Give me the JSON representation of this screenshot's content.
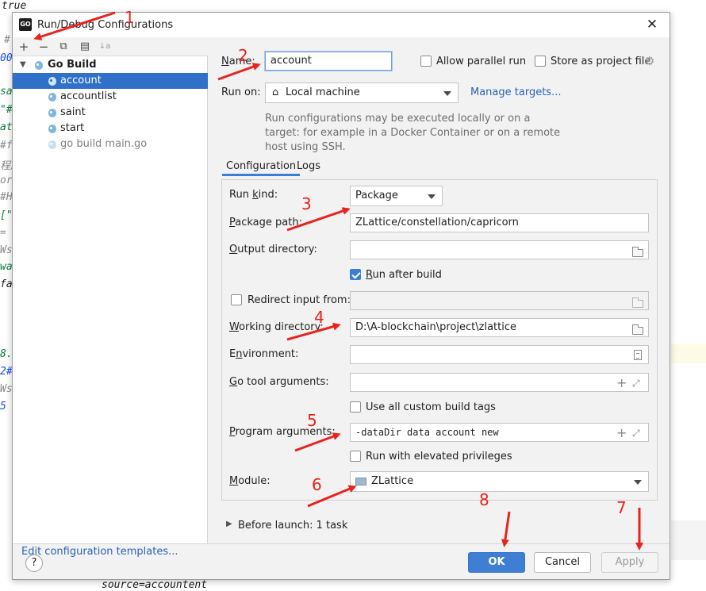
{
  "editor": {
    "lines": [
      {
        "text": "true",
        "color": "#1a1a1a"
      },
      {
        "text": "#自动见证,默认使用第一个账户进行见证",
        "color": "#8a8a8a"
      },
      {
        "text": "#",
        "color": "#8a8a8a"
      },
      {
        "text": "00",
        "color": "#1750eb"
      },
      {
        "text": "sa",
        "color": "#0a7a3a"
      },
      {
        "text": "\"#",
        "color": "#0a7a3a"
      },
      {
        "text": "at",
        "color": "#0a7a3a"
      },
      {
        "text": "#f",
        "color": "#8a8a8a"
      },
      {
        "text": "程序",
        "color": "#8a8a8a"
      },
      {
        "text": "or",
        "color": "#8a8a8a"
      },
      {
        "text": "#H",
        "color": "#8a8a8a"
      },
      {
        "text": "[\"",
        "color": "#0a7a3a"
      },
      {
        "text": "=",
        "color": "#8a8a8a"
      },
      {
        "text": "Ws",
        "color": "#8a8a8a"
      },
      {
        "text": "wa",
        "color": "#0a7a3a"
      },
      {
        "text": "fa",
        "color": "#1a1a1a"
      },
      {
        "text": "8.",
        "color": "#0a7a3a"
      },
      {
        "text": "2#",
        "color": "#1750eb"
      },
      {
        "text": "Ws",
        "color": "#8a8a8a"
      },
      {
        "text": "5",
        "color": "#1750eb"
      },
      {
        "text": "source=accountent",
        "color": "#1a1a1a"
      }
    ]
  },
  "dialog": {
    "app_icon": "GO",
    "title": "Run/Debug Configurations",
    "close": "✕",
    "toolbar_icons": [
      "add-icon",
      "remove-icon",
      "copy-icon",
      "folder-add-icon",
      "sort-icon"
    ],
    "toolbar_glyphs": [
      "+",
      "−",
      "⧉",
      "▤",
      "↓a"
    ],
    "tree": {
      "group": "Go Build",
      "items": [
        "account",
        "accountlist",
        "saint",
        "start",
        "go build main.go"
      ]
    },
    "edit_templates": "Edit configuration templates...",
    "name_label": "Name:",
    "name_value": "account",
    "allow_parallel": "Allow parallel run",
    "store_project": "Store as project file",
    "run_on_label": "Run on:",
    "run_on_value": "Local machine",
    "manage_targets": "Manage targets...",
    "hint": "Run configurations may be executed locally or on a target: for example in a Docker Container or on a remote host using SSH.",
    "tabs": [
      "Configuration",
      "Logs"
    ],
    "run_kind_label": "Run kind:",
    "run_kind_value": "Package",
    "package_path_label": "Package path:",
    "package_path_value": "ZLattice/constellation/capricorn",
    "output_dir_label": "Output directory:",
    "output_dir_value": "",
    "run_after_build": "Run after build",
    "redirect_input": "Redirect input from:",
    "working_dir_label": "Working directory:",
    "working_dir_value": "D:\\A-blockchain\\project\\zlattice",
    "environment_label": "Environment:",
    "go_tool_args_label": "Go tool arguments:",
    "use_custom_tags": "Use all custom build tags",
    "program_args_label": "Program arguments:",
    "program_args_value": "-dataDir data account new",
    "run_elevated": "Run with elevated privileges",
    "module_label": "Module:",
    "module_value": "ZLattice",
    "before_launch": "Before launch: 1 task",
    "buttons": {
      "ok": "OK",
      "cancel": "Cancel",
      "apply": "Apply",
      "help": "?"
    }
  },
  "annotations": [
    "1",
    "2",
    "3",
    "4",
    "5",
    "6",
    "7",
    "8"
  ],
  "colors": {
    "accent": "#3f7fd3",
    "selection": "#2f70c9",
    "annotation": "#e8231d",
    "link": "#2a61b5"
  }
}
